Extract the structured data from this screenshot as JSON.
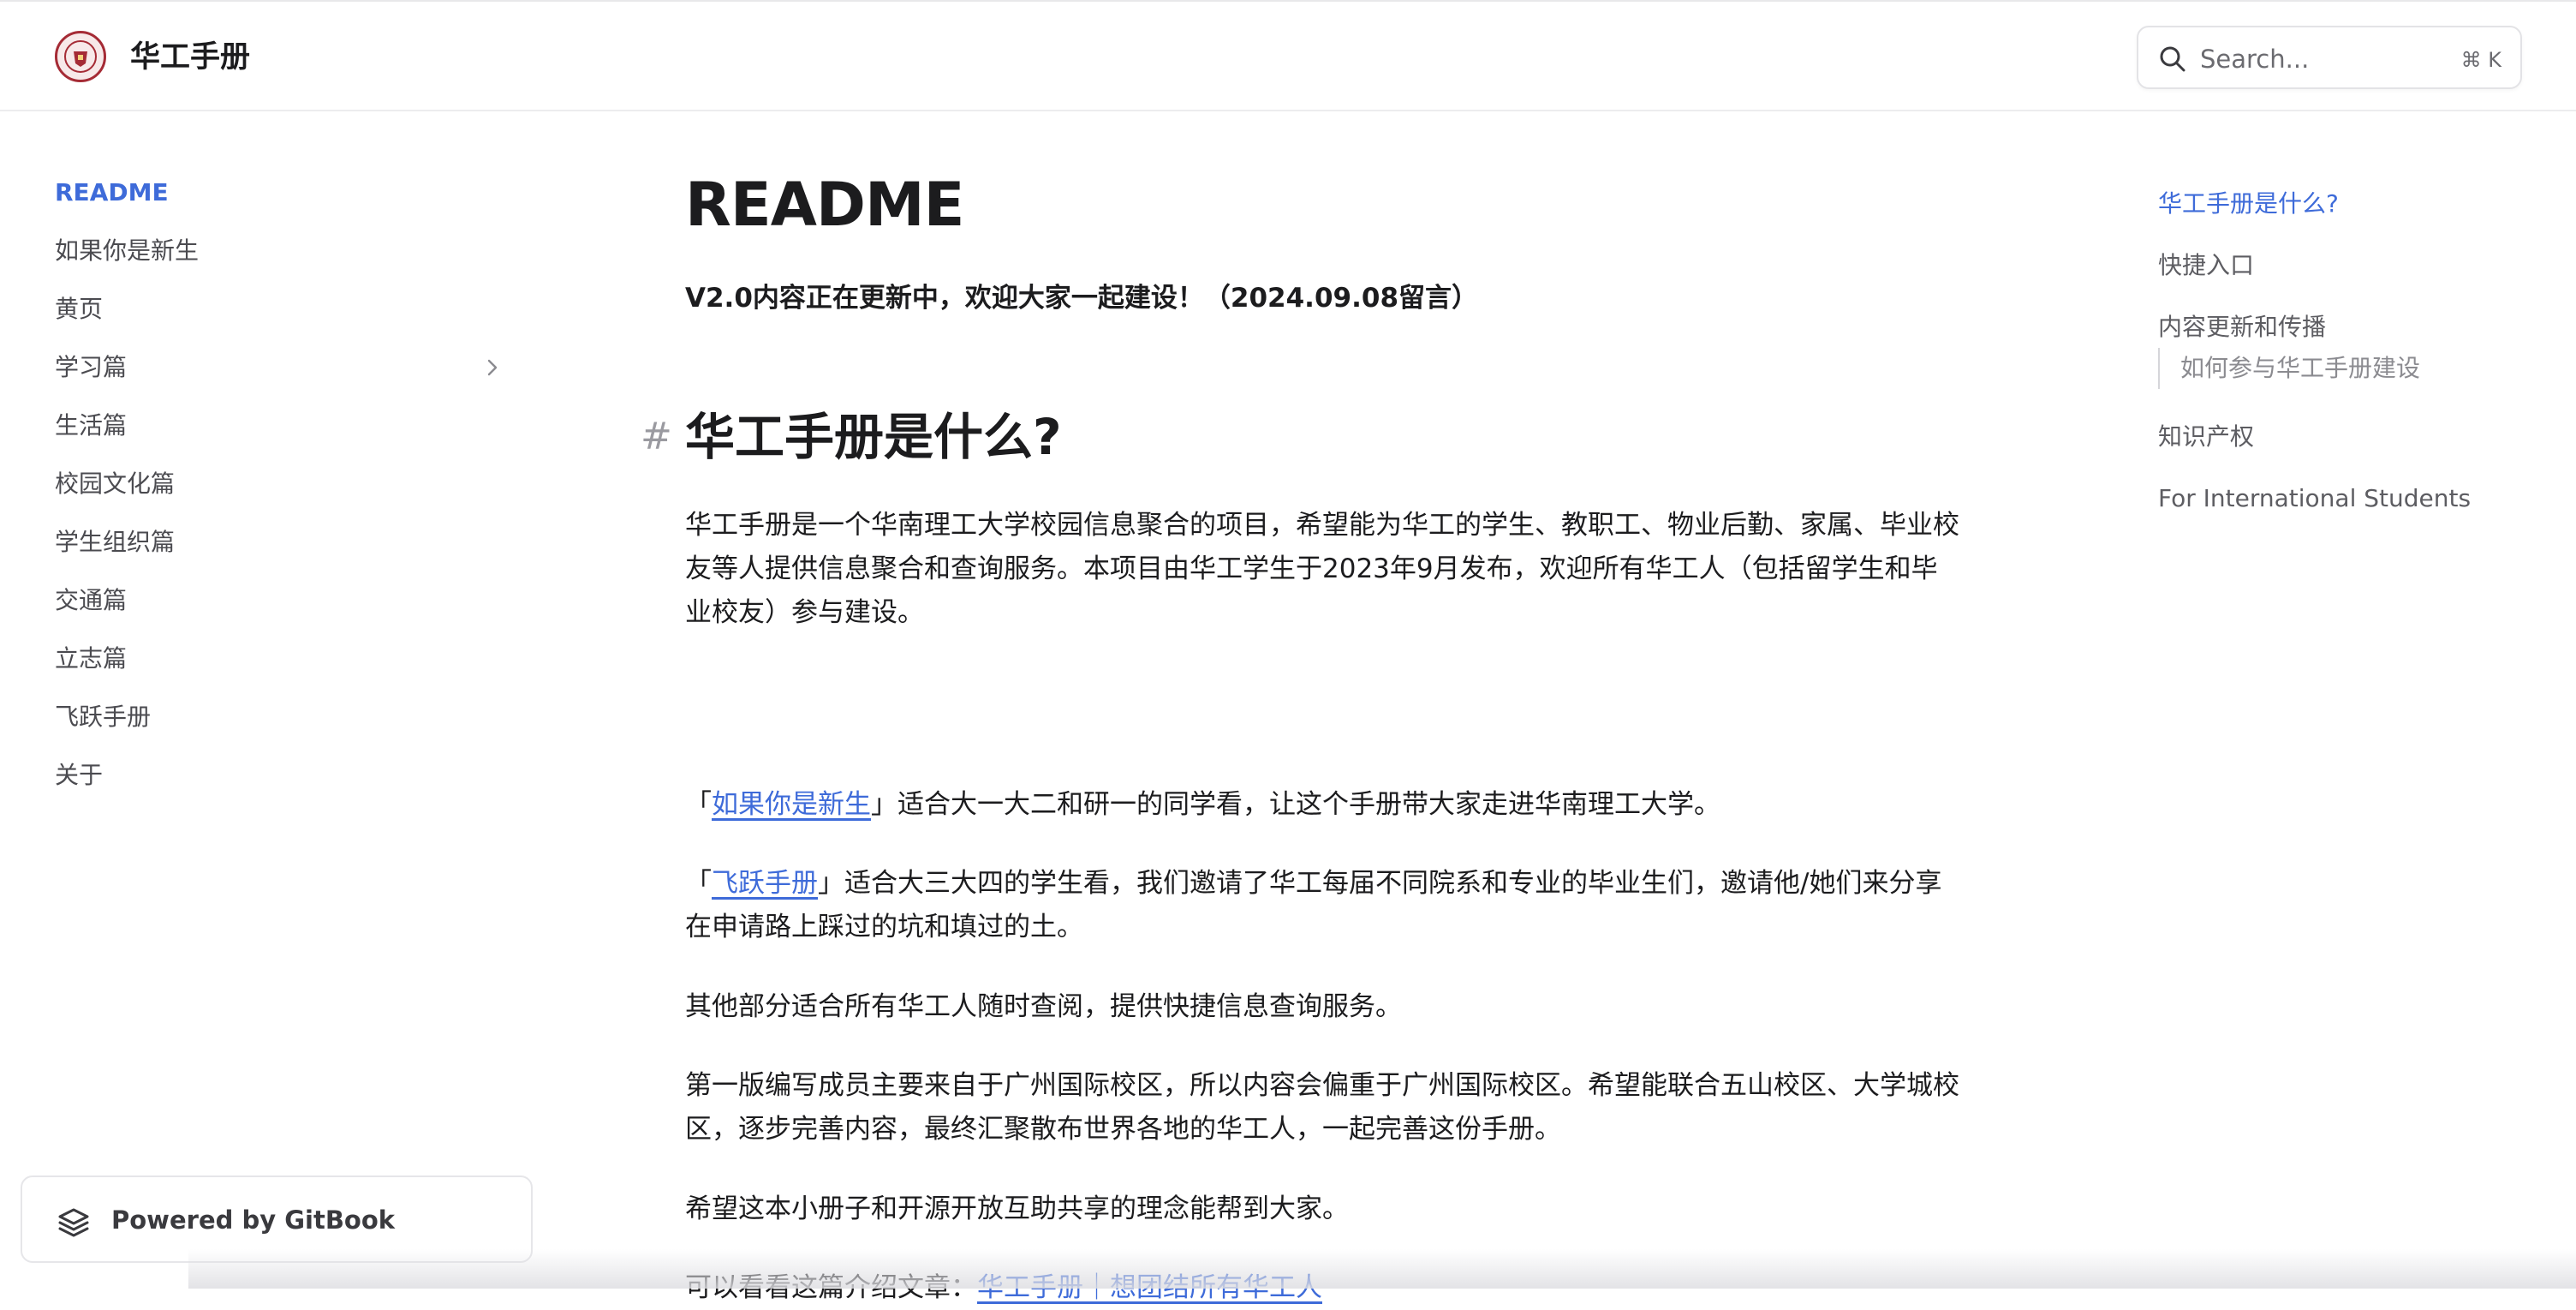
{
  "header": {
    "site_title": "华工手册",
    "search": {
      "placeholder": "Search...",
      "shortcut": "⌘ K"
    }
  },
  "sidebar": {
    "items": [
      {
        "label": "README",
        "active": true
      },
      {
        "label": "如果你是新生"
      },
      {
        "label": "黄页"
      },
      {
        "label": "学习篇",
        "expandable": true
      },
      {
        "label": "生活篇"
      },
      {
        "label": "校园文化篇"
      },
      {
        "label": "学生组织篇"
      },
      {
        "label": "交通篇"
      },
      {
        "label": "立志篇"
      },
      {
        "label": "飞跃手册"
      },
      {
        "label": "关于"
      }
    ],
    "powered_by": "Powered by GitBook"
  },
  "main": {
    "title": "README",
    "notice": "V2.0内容正在更新中，欢迎大家一起建设！（2024.09.08留言）",
    "section_heading": "华工手册是什么?",
    "anchor_symbol": "#",
    "paragraphs": {
      "intro_1": "华工手册是一个华南理工大学校园信息聚合的项目，希望能为华工的学生、教职工、物业后勤、家属、毕业校",
      "intro_2": "友等人提供信息聚合和查询服务。本项目由华工学生于2023年9月发布，欢迎所有华工人（包括留学生和毕",
      "intro_3": "业校友）参与建设。",
      "freshman_open": "「",
      "freshman_link": "如果你是新生",
      "freshman_rest": "」适合大一大二和研一的同学看，让这个手册带大家走进华南理工大学。",
      "leap_open": "「",
      "leap_link": "飞跃手册",
      "leap_rest_1": "」适合大三大四的学生看，我们邀请了华工每届不同院系和专业的毕业生们，邀请他/她们来分享",
      "leap_rest_2": "在申请路上踩过的坑和填过的土。",
      "others": "其他部分适合所有华工人随时查阅，提供快捷信息查询服务。",
      "first_edition_1": "第一版编写成员主要来自于广州国际校区，所以内容会偏重于广州国际校区。希望能联合五山校区、大学城校",
      "first_edition_2": "区，逐步完善内容，最终汇聚散布世界各地的华工人，一起完善这份手册。",
      "hope": "希望这本小册子和开源开放互助共享的理念能帮到大家。",
      "article_prefix": "可以看看这篇介绍文章：",
      "article_link": "华工手册｜想团结所有华工人"
    }
  },
  "toc": {
    "items": [
      {
        "label": "华工手册是什么?",
        "active": true
      },
      {
        "label": "快捷入口"
      },
      {
        "label": "内容更新和传播"
      },
      {
        "label": "知识产权"
      },
      {
        "label": "For International Students"
      }
    ],
    "sub_item": "如何参与华工手册建设"
  },
  "colors": {
    "accent": "#3e6bd9",
    "text": "#1c1c1e",
    "muted": "#5d5d62",
    "logo_red": "#a52b35"
  },
  "icons": {
    "search": "search-icon",
    "chevron": "chevron-right-icon",
    "gitbook": "gitbook-logo-icon",
    "logo": "university-seal-logo"
  }
}
